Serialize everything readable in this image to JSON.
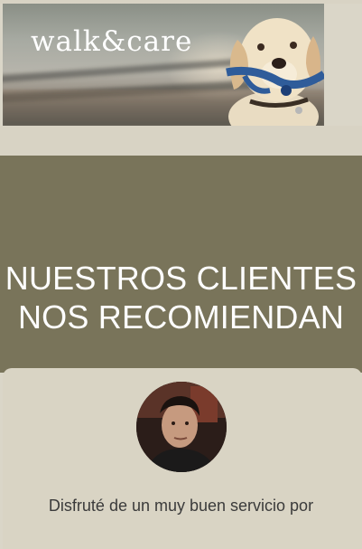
{
  "header": {
    "logo_text": "walk&care"
  },
  "section": {
    "headline_line1": "NUESTROS CLIENTES",
    "headline_line2": "NOS RECOMIENDAN"
  },
  "testimonial": {
    "text": "Disfruté de un muy buen servicio por"
  },
  "colors": {
    "dark_band": "#79745a",
    "light_band": "#d8d3c4",
    "headline_text": "#ffffff"
  }
}
